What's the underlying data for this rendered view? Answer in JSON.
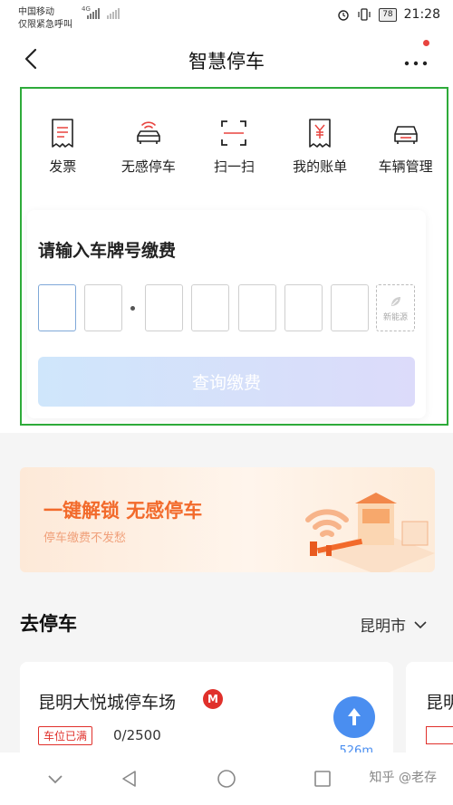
{
  "status_bar": {
    "carrier_line1": "中国移动",
    "carrier_line2": "仅限紧急呼叫",
    "network_tag": "4G",
    "battery": "78",
    "time": "21:28"
  },
  "nav": {
    "title": "智慧停车"
  },
  "quick_actions": [
    {
      "label": "发票",
      "icon": "invoice-icon"
    },
    {
      "label": "无感停车",
      "icon": "contactless-car-icon"
    },
    {
      "label": "扫一扫",
      "icon": "scan-icon"
    },
    {
      "label": "我的账单",
      "icon": "bill-icon"
    },
    {
      "label": "车辆管理",
      "icon": "car-icon"
    }
  ],
  "plate": {
    "title": "请输入车牌号缴费",
    "new_energy_label": "新能源",
    "query_button": "查询缴费"
  },
  "banner": {
    "title": "一键解锁 无感停车",
    "subtitle": "停车缴费不发愁"
  },
  "go_park": {
    "title": "去停车",
    "city": "昆明市"
  },
  "lots": [
    {
      "name": "昆明大悦城停车场",
      "status": "车位已满",
      "spaces": "0/2500",
      "distance": "526m"
    },
    {
      "name": "昆明"
    }
  ],
  "watermark": "知乎 @老存",
  "colors": {
    "frame": "#2eab3a",
    "accent_orange": "#f26a2b",
    "nav_blue": "#4a8ef0",
    "full_red": "#e0302b"
  }
}
